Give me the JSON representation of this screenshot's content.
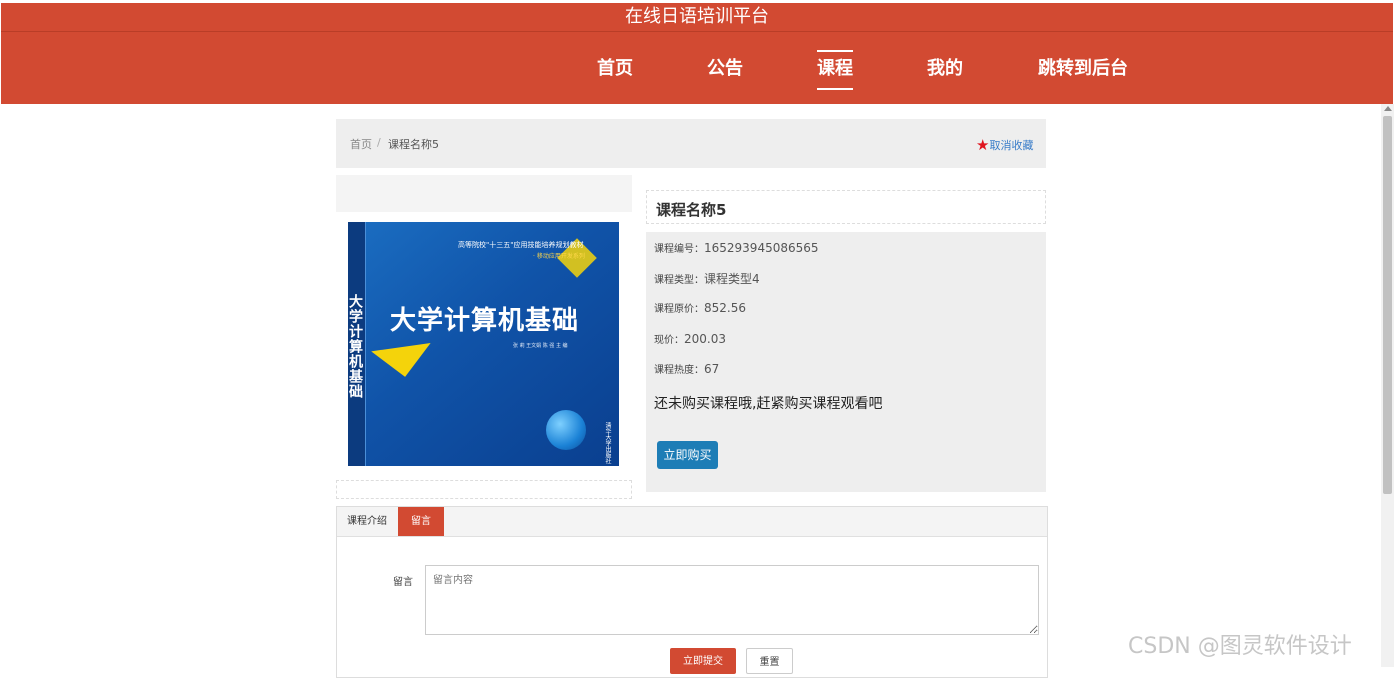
{
  "header": {
    "site_title": "在线日语培训平台"
  },
  "nav": {
    "items": [
      "首页",
      "公告",
      "课程",
      "我的",
      "跳转到后台"
    ],
    "active_index": 2
  },
  "breadcrumb": {
    "home": "首页",
    "separator": "/",
    "current": "课程名称5"
  },
  "favorite": {
    "label": "取消收藏",
    "icon": "star-icon"
  },
  "course": {
    "title": "课程名称5",
    "fields": [
      {
        "label": "课程编号：",
        "value": "165293945086565"
      },
      {
        "label": "课程类型：",
        "value": "课程类型4"
      },
      {
        "label": "课程原价：",
        "value": "852.56"
      },
      {
        "label": "现价：",
        "value": "200.03"
      },
      {
        "label": "课程热度：",
        "value": "67"
      }
    ],
    "notice": "还未购买课程哦,赶紧购买课程观看吧",
    "buy_button": "立即购买"
  },
  "cover": {
    "series_line1": "高等院校\"十三五\"应用技能培养规划教材",
    "series_line2": "· 移动应用开发系列",
    "title": "大学计算机基础",
    "spine_title": "大学计算机基础",
    "authors": "张 莉  王文娟  陈 强  主 编",
    "publisher": "清华大学出版社"
  },
  "tabs": {
    "items": [
      "课程介绍",
      "留言"
    ],
    "active_index": 1
  },
  "comment_form": {
    "label": "留言",
    "placeholder": "留言内容",
    "submit": "立即提交",
    "reset": "重置"
  },
  "watermark": "CSDN @图灵软件设计",
  "colors": {
    "brand": "#d24a32",
    "button_blue": "#1d7db6",
    "star": "#e0141e"
  }
}
